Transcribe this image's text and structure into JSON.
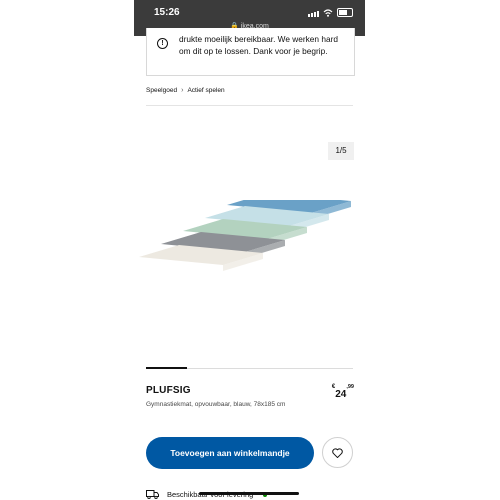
{
  "status_bar": {
    "time": "15:26",
    "url": "ikea.com"
  },
  "notice": {
    "text": "drukte moeilijk bereikbaar. We werken hard om dit op te lossen. Dank voor je begrip."
  },
  "breadcrumb": [
    "Speelgoed",
    "Actief spelen"
  ],
  "gallery": {
    "pager": "1/5"
  },
  "mat_colors": [
    "#ede9e1",
    "#8e9196",
    "#b3d2bf",
    "#c5e0e7",
    "#6aa1c7"
  ],
  "product": {
    "name": "PLUFSIG",
    "description": "Gymnastiekmat, opvouwbaar, blauw, 78x185 cm",
    "price": {
      "currency": "€",
      "integer": "24",
      "decimal": ",99"
    }
  },
  "actions": {
    "add_to_cart": "Toevoegen aan winkelmandje"
  },
  "delivery": {
    "text": "Beschikbaar voor levering"
  },
  "colors": {
    "accent": "#0058a3",
    "status_bar": "#3b3b3b",
    "available": "#0a8a00"
  }
}
